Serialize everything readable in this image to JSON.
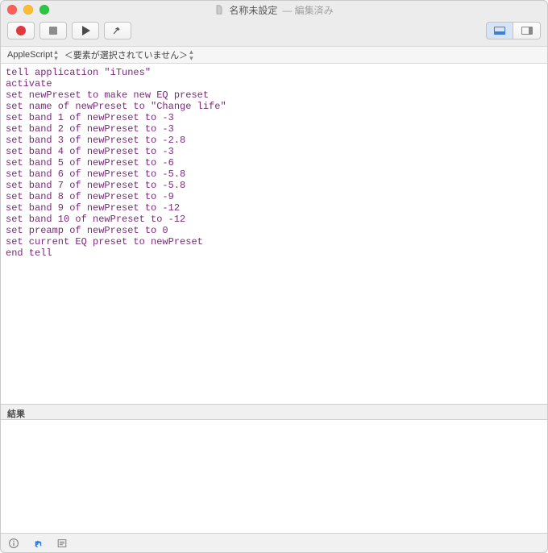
{
  "window": {
    "title": "名称未設定",
    "subtitle": "— 編集済み"
  },
  "navbar": {
    "language": "AppleScript",
    "selector": "＜要素が選択されていません＞"
  },
  "code_lines": [
    "tell application \"iTunes\"",
    "activate",
    "set newPreset to make new EQ preset",
    "set name of newPreset to \"Change life\"",
    "set band 1 of newPreset to -3",
    "set band 2 of newPreset to -3",
    "set band 3 of newPreset to -2.8",
    "set band 4 of newPreset to -3",
    "set band 5 of newPreset to -6",
    "set band 6 of newPreset to -5.8",
    "set band 7 of newPreset to -5.8",
    "set band 8 of newPreset to -9",
    "set band 9 of newPreset to -12",
    "set band 10 of newPreset to -12",
    "set preamp of newPreset to 0",
    "set current EQ preset to newPreset",
    "end tell"
  ],
  "results": {
    "label": "結果"
  }
}
